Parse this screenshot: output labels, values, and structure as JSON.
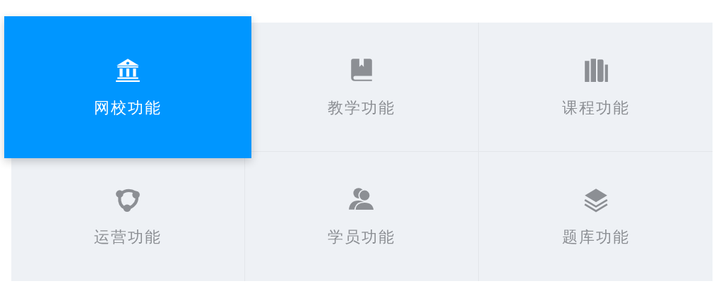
{
  "features": [
    {
      "label": "网校功能",
      "selected": true
    },
    {
      "label": "教学功能",
      "selected": false
    },
    {
      "label": "课程功能",
      "selected": false
    },
    {
      "label": "运营功能",
      "selected": false
    },
    {
      "label": "学员功能",
      "selected": false
    },
    {
      "label": "题库功能",
      "selected": false
    }
  ]
}
